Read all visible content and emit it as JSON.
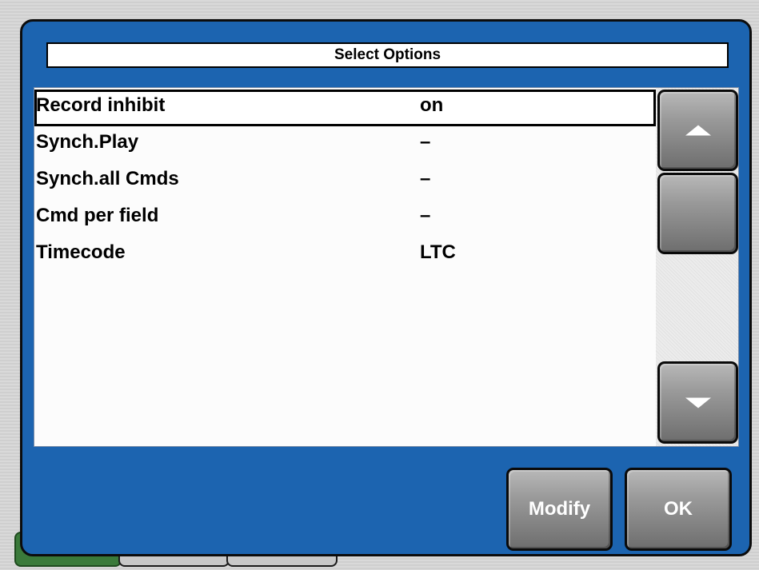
{
  "dialog": {
    "title": "Select Options"
  },
  "options": [
    {
      "name": "Record inhibit",
      "value": "on",
      "selected": true
    },
    {
      "name": "Synch.Play",
      "value": "–",
      "selected": false
    },
    {
      "name": "Synch.all Cmds",
      "value": "–",
      "selected": false
    },
    {
      "name": "Cmd per field",
      "value": "–",
      "selected": false
    },
    {
      "name": "Timecode",
      "value": "LTC",
      "selected": false
    }
  ],
  "scrollbar": {
    "up_icon": "triangle-up-icon",
    "down_icon": "triangle-down-icon"
  },
  "buttons": {
    "modify_label": "Modify",
    "ok_label": "OK"
  },
  "colors": {
    "dialog_bg": "#1c64b0",
    "list_bg": "#fcfcfc",
    "button_gray": "#8a8a8a"
  }
}
